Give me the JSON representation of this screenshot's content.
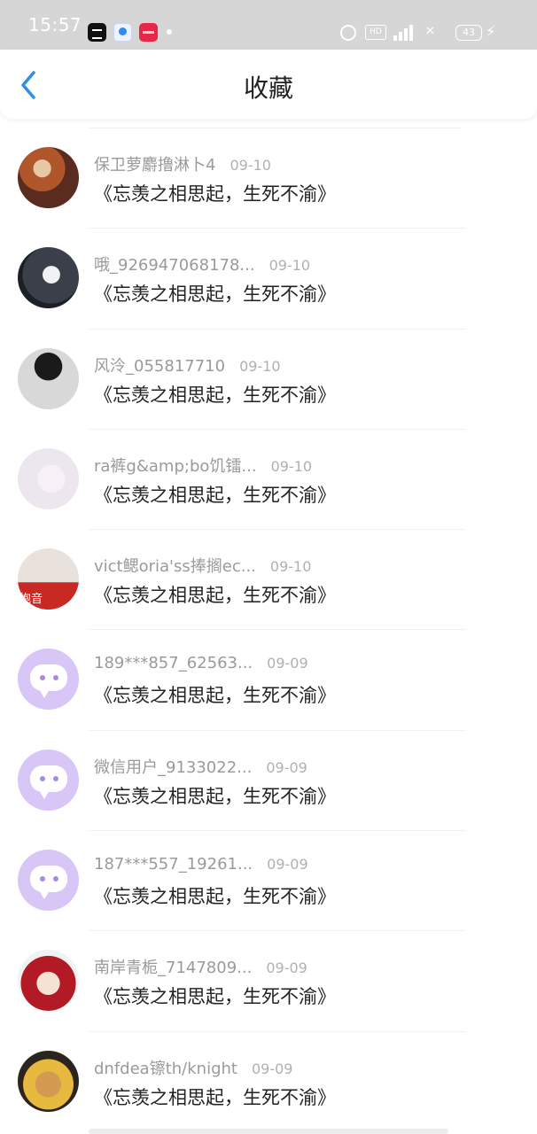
{
  "status_bar": {
    "time": "15:57",
    "network": "4G",
    "battery": "43"
  },
  "header": {
    "title": "收藏"
  },
  "items": [
    {
      "name": "保卫萝麝撸淋卜4",
      "date": "09-10",
      "title": "《忘羡之相思起，生死不渝》"
    },
    {
      "name": "哦_926947068178...",
      "date": "09-10",
      "title": "《忘羡之相思起，生死不渝》"
    },
    {
      "name": "风泠_055817710",
      "date": "09-10",
      "title": "《忘羡之相思起，生死不渝》"
    },
    {
      "name": "ra裤g&amp;bo饥镭...",
      "date": "09-10",
      "title": "《忘羡之相思起，生死不渝》"
    },
    {
      "name": "vict鳃oria'ss捧搁ec...",
      "date": "09-10",
      "title": "《忘羡之相思起，生死不渝》",
      "avatar_text": "抱音"
    },
    {
      "name": "189***857_62563...",
      "date": "09-09",
      "title": "《忘羡之相思起，生死不渝》"
    },
    {
      "name": "微信用户_9133022...",
      "date": "09-09",
      "title": "《忘羡之相思起，生死不渝》"
    },
    {
      "name": "187***557_19261...",
      "date": "09-09",
      "title": "《忘羡之相思起，生死不渝》"
    },
    {
      "name": "南岸青栀_7147809...",
      "date": "09-09",
      "title": "《忘羡之相思起，生死不渝》"
    },
    {
      "name": "dnfdea镲th/knight",
      "date": "09-09",
      "title": "《忘羡之相思起，生死不渝》"
    }
  ]
}
